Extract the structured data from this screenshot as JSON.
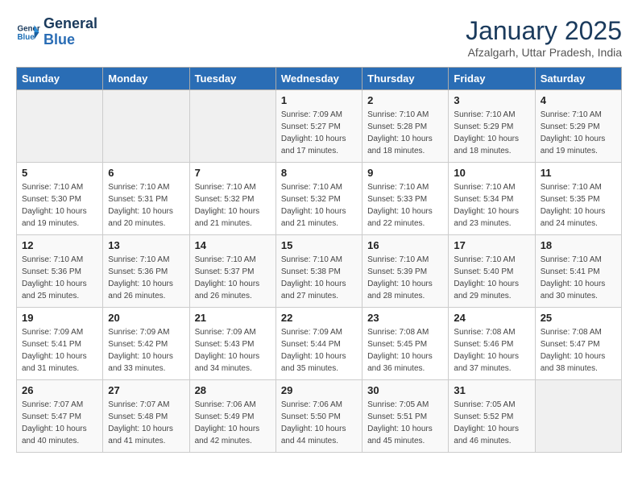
{
  "header": {
    "logo_line1": "General",
    "logo_line2": "Blue",
    "month": "January 2025",
    "location": "Afzalgarh, Uttar Pradesh, India"
  },
  "days_of_week": [
    "Sunday",
    "Monday",
    "Tuesday",
    "Wednesday",
    "Thursday",
    "Friday",
    "Saturday"
  ],
  "weeks": [
    [
      {
        "day": "",
        "info": ""
      },
      {
        "day": "",
        "info": ""
      },
      {
        "day": "",
        "info": ""
      },
      {
        "day": "1",
        "info": "Sunrise: 7:09 AM\nSunset: 5:27 PM\nDaylight: 10 hours\nand 17 minutes."
      },
      {
        "day": "2",
        "info": "Sunrise: 7:10 AM\nSunset: 5:28 PM\nDaylight: 10 hours\nand 18 minutes."
      },
      {
        "day": "3",
        "info": "Sunrise: 7:10 AM\nSunset: 5:29 PM\nDaylight: 10 hours\nand 18 minutes."
      },
      {
        "day": "4",
        "info": "Sunrise: 7:10 AM\nSunset: 5:29 PM\nDaylight: 10 hours\nand 19 minutes."
      }
    ],
    [
      {
        "day": "5",
        "info": "Sunrise: 7:10 AM\nSunset: 5:30 PM\nDaylight: 10 hours\nand 19 minutes."
      },
      {
        "day": "6",
        "info": "Sunrise: 7:10 AM\nSunset: 5:31 PM\nDaylight: 10 hours\nand 20 minutes."
      },
      {
        "day": "7",
        "info": "Sunrise: 7:10 AM\nSunset: 5:32 PM\nDaylight: 10 hours\nand 21 minutes."
      },
      {
        "day": "8",
        "info": "Sunrise: 7:10 AM\nSunset: 5:32 PM\nDaylight: 10 hours\nand 21 minutes."
      },
      {
        "day": "9",
        "info": "Sunrise: 7:10 AM\nSunset: 5:33 PM\nDaylight: 10 hours\nand 22 minutes."
      },
      {
        "day": "10",
        "info": "Sunrise: 7:10 AM\nSunset: 5:34 PM\nDaylight: 10 hours\nand 23 minutes."
      },
      {
        "day": "11",
        "info": "Sunrise: 7:10 AM\nSunset: 5:35 PM\nDaylight: 10 hours\nand 24 minutes."
      }
    ],
    [
      {
        "day": "12",
        "info": "Sunrise: 7:10 AM\nSunset: 5:36 PM\nDaylight: 10 hours\nand 25 minutes."
      },
      {
        "day": "13",
        "info": "Sunrise: 7:10 AM\nSunset: 5:36 PM\nDaylight: 10 hours\nand 26 minutes."
      },
      {
        "day": "14",
        "info": "Sunrise: 7:10 AM\nSunset: 5:37 PM\nDaylight: 10 hours\nand 26 minutes."
      },
      {
        "day": "15",
        "info": "Sunrise: 7:10 AM\nSunset: 5:38 PM\nDaylight: 10 hours\nand 27 minutes."
      },
      {
        "day": "16",
        "info": "Sunrise: 7:10 AM\nSunset: 5:39 PM\nDaylight: 10 hours\nand 28 minutes."
      },
      {
        "day": "17",
        "info": "Sunrise: 7:10 AM\nSunset: 5:40 PM\nDaylight: 10 hours\nand 29 minutes."
      },
      {
        "day": "18",
        "info": "Sunrise: 7:10 AM\nSunset: 5:41 PM\nDaylight: 10 hours\nand 30 minutes."
      }
    ],
    [
      {
        "day": "19",
        "info": "Sunrise: 7:09 AM\nSunset: 5:41 PM\nDaylight: 10 hours\nand 31 minutes."
      },
      {
        "day": "20",
        "info": "Sunrise: 7:09 AM\nSunset: 5:42 PM\nDaylight: 10 hours\nand 33 minutes."
      },
      {
        "day": "21",
        "info": "Sunrise: 7:09 AM\nSunset: 5:43 PM\nDaylight: 10 hours\nand 34 minutes."
      },
      {
        "day": "22",
        "info": "Sunrise: 7:09 AM\nSunset: 5:44 PM\nDaylight: 10 hours\nand 35 minutes."
      },
      {
        "day": "23",
        "info": "Sunrise: 7:08 AM\nSunset: 5:45 PM\nDaylight: 10 hours\nand 36 minutes."
      },
      {
        "day": "24",
        "info": "Sunrise: 7:08 AM\nSunset: 5:46 PM\nDaylight: 10 hours\nand 37 minutes."
      },
      {
        "day": "25",
        "info": "Sunrise: 7:08 AM\nSunset: 5:47 PM\nDaylight: 10 hours\nand 38 minutes."
      }
    ],
    [
      {
        "day": "26",
        "info": "Sunrise: 7:07 AM\nSunset: 5:47 PM\nDaylight: 10 hours\nand 40 minutes."
      },
      {
        "day": "27",
        "info": "Sunrise: 7:07 AM\nSunset: 5:48 PM\nDaylight: 10 hours\nand 41 minutes."
      },
      {
        "day": "28",
        "info": "Sunrise: 7:06 AM\nSunset: 5:49 PM\nDaylight: 10 hours\nand 42 minutes."
      },
      {
        "day": "29",
        "info": "Sunrise: 7:06 AM\nSunset: 5:50 PM\nDaylight: 10 hours\nand 44 minutes."
      },
      {
        "day": "30",
        "info": "Sunrise: 7:05 AM\nSunset: 5:51 PM\nDaylight: 10 hours\nand 45 minutes."
      },
      {
        "day": "31",
        "info": "Sunrise: 7:05 AM\nSunset: 5:52 PM\nDaylight: 10 hours\nand 46 minutes."
      },
      {
        "day": "",
        "info": ""
      }
    ]
  ]
}
